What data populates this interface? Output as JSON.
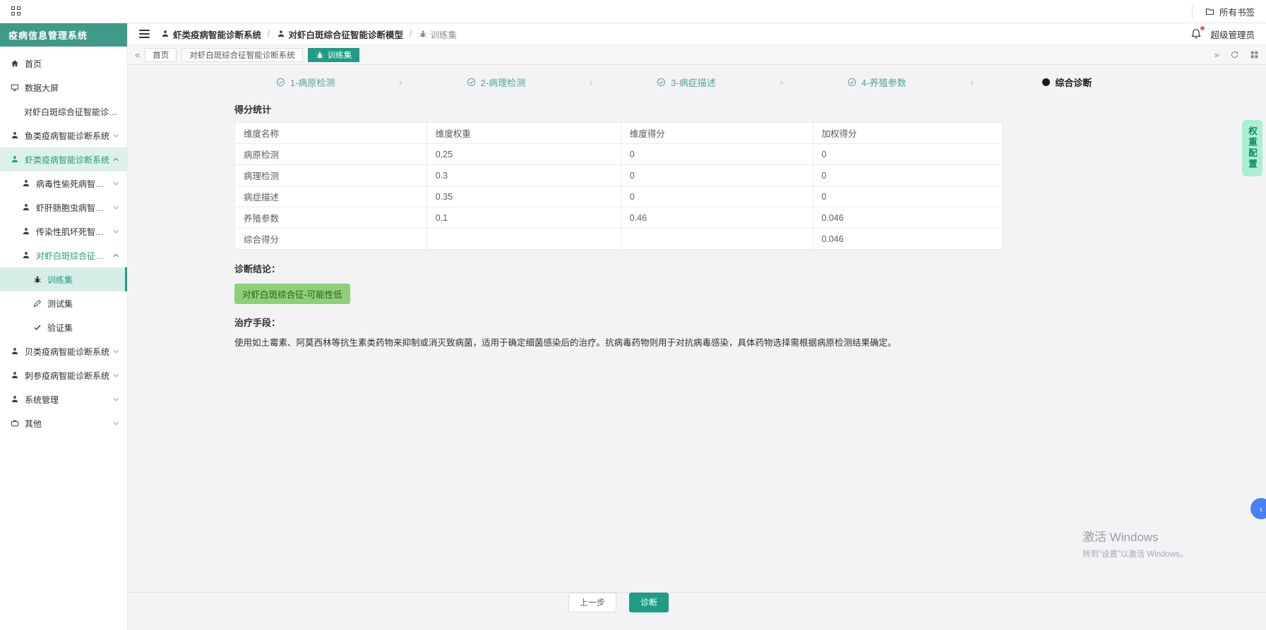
{
  "browser": {
    "all_bookmarks": "所有书签"
  },
  "sidebar": {
    "title": "疫病信息管理系统",
    "items": [
      {
        "label": "首页",
        "icon": "home-icon"
      },
      {
        "label": "数据大屏",
        "icon": "screen-icon"
      },
      {
        "label": "对虾白斑综合征智能诊断系统",
        "icon": "none"
      },
      {
        "label": "鱼类疫病智能诊断系统",
        "icon": "person-icon"
      },
      {
        "label": "虾类疫病智能诊断系统",
        "icon": "person-icon"
      },
      {
        "label": "病毒性偷死病智能诊断模型",
        "icon": "person-icon"
      },
      {
        "label": "虾肝肠胞虫病智能诊断模型",
        "icon": "person-icon"
      },
      {
        "label": "传染性肌坏死智能诊断模型",
        "icon": "person-icon"
      },
      {
        "label": "对虾白斑综合征智能诊断模型",
        "icon": "person-icon"
      },
      {
        "label": "训练集",
        "icon": "bug-icon"
      },
      {
        "label": "测试集",
        "icon": "pencil-icon"
      },
      {
        "label": "验证集",
        "icon": "check-icon"
      },
      {
        "label": "贝类疫病智能诊断系统",
        "icon": "person-icon"
      },
      {
        "label": "刺参疫病智能诊断系统",
        "icon": "person-icon"
      },
      {
        "label": "系统管理",
        "icon": "user-icon"
      },
      {
        "label": "其他",
        "icon": "briefcase-icon"
      }
    ]
  },
  "topbar": {
    "breadcrumb": [
      {
        "label": "虾类疫病智能诊断系统",
        "icon": "person-icon"
      },
      {
        "label": "对虾白斑综合征智能诊断模型",
        "icon": "person-icon"
      },
      {
        "label": "训练集",
        "icon": "bug-icon"
      }
    ],
    "separator": "/",
    "user": "超级管理员"
  },
  "tabbar": {
    "tabs": [
      {
        "label": "首页",
        "active": false
      },
      {
        "label": "对虾白斑综合征智能诊断系统",
        "active": false
      },
      {
        "label": "训练集",
        "active": true
      }
    ]
  },
  "stepper": {
    "steps": [
      {
        "label": "1-病原检测",
        "state": "done"
      },
      {
        "label": "2-病理检测",
        "state": "done"
      },
      {
        "label": "3-病症描述",
        "state": "done"
      },
      {
        "label": "4-养殖参数",
        "state": "done"
      },
      {
        "label": "综合诊断",
        "state": "current"
      }
    ]
  },
  "main": {
    "score_title": "得分统计",
    "table": {
      "headers": [
        "维度名称",
        "维度权重",
        "维度得分",
        "加权得分"
      ],
      "rows": [
        [
          "病原检测",
          "0.25",
          "0",
          "0"
        ],
        [
          "病理检测",
          "0.3",
          "0",
          "0"
        ],
        [
          "病症描述",
          "0.35",
          "0",
          "0"
        ],
        [
          "养殖参数",
          "0.1",
          "0.46",
          "0.046"
        ],
        [
          "综合得分",
          "",
          "",
          "0.046"
        ]
      ]
    },
    "conclusion_label": "诊断结论：",
    "conclusion_badge": "对虾白斑综合征-可能性低",
    "treatment_label": "治疗手段：",
    "treatment_text": "使用如土霉素、阿莫西林等抗生素类药物来抑制或消灭致病菌，适用于确定细菌感染后的治疗。抗病毒药物则用于对抗病毒感染，具体药物选择需根据病原检测结果确定。",
    "prev_button": "上一步",
    "diagnose_button": "诊断"
  },
  "floating": {
    "weight_tab": "权重配置"
  },
  "watermark": {
    "line1": "激活 Windows",
    "line2": "转到“设置”以激活 Windows。"
  },
  "colors": {
    "primary": "#1f9c85",
    "sidebar_header": "#409a8a",
    "badge_bg": "#8ed077",
    "badge_text": "#2f5c22",
    "weight_tab_bg": "#a9efd0",
    "weight_tab_text": "#0e8a63",
    "fab_blue": "#4a80f5",
    "notification_red": "#f05b50"
  }
}
